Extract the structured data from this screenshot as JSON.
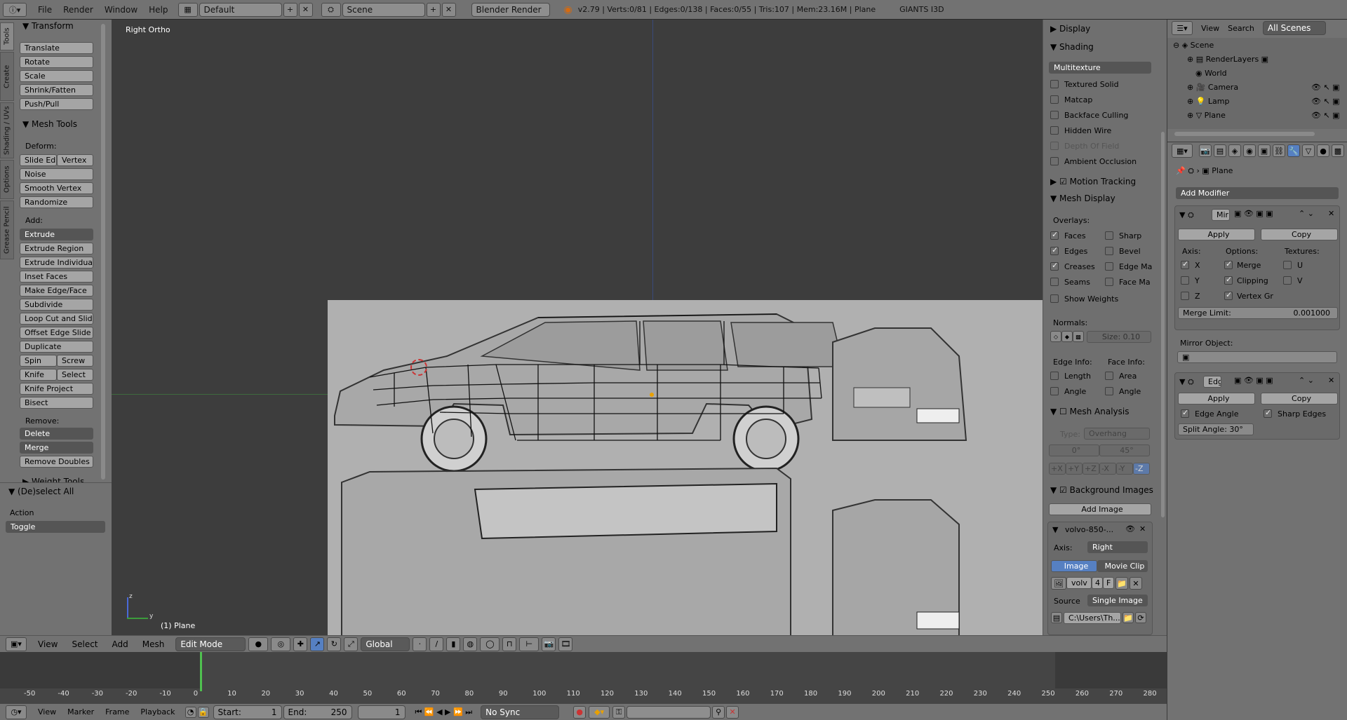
{
  "topbar": {
    "menus": [
      "File",
      "Render",
      "Window",
      "Help"
    ],
    "layout": "Default",
    "scene": "Scene",
    "engine": "Blender Render",
    "stats": "v2.79 | Verts:0/81 | Edges:0/138 | Faces:0/55 | Tris:107 | Mem:23.16M | Plane",
    "addon": "GIANTS I3D"
  },
  "tool_tabs": [
    "Tools",
    "Create",
    "Shading / UVs",
    "Options",
    "Grease Pencil"
  ],
  "tools": {
    "transform_title": "Transform",
    "transform": [
      "Translate",
      "Rotate",
      "Scale",
      "Shrink/Fatten",
      "Push/Pull"
    ],
    "mesh_tools_title": "Mesh Tools",
    "deform_label": "Deform:",
    "slide_edge": "Slide Ed",
    "vertex": "Vertex",
    "deform": [
      "Noise",
      "Smooth Vertex",
      "Randomize"
    ],
    "add_label": "Add:",
    "extrude": "Extrude",
    "add": [
      "Extrude Region",
      "Extrude Individual",
      "Inset Faces",
      "Make Edge/Face",
      "Subdivide",
      "Loop Cut and Slide",
      "Offset Edge Slide",
      "Duplicate"
    ],
    "spin": "Spin",
    "screw": "Screw",
    "knife": "Knife",
    "select": "Select",
    "knife_project": "Knife Project",
    "bisect": "Bisect",
    "remove_label": "Remove:",
    "delete": "Delete",
    "merge": "Merge",
    "remove_doubles": "Remove Doubles",
    "weight_tools": "Weight Tools"
  },
  "operator": {
    "title": "(De)select All",
    "action_label": "Action",
    "action_value": "Toggle"
  },
  "viewport": {
    "view_name": "Right Ortho",
    "object_label": "(1) Plane",
    "axis_z": "z",
    "axis_y": "y"
  },
  "viewport_header": {
    "menus": [
      "View",
      "Select",
      "Add",
      "Mesh"
    ],
    "mode": "Edit Mode",
    "orientation": "Global"
  },
  "properties_n": {
    "display": "Display",
    "shading": "Shading",
    "shading_mode": "Multitexture",
    "shading_opts": [
      {
        "label": "Textured Solid",
        "on": false
      },
      {
        "label": "Matcap",
        "on": false
      },
      {
        "label": "Backface Culling",
        "on": false
      },
      {
        "label": "Hidden Wire",
        "on": false
      },
      {
        "label": "Depth Of Field",
        "on": false
      },
      {
        "label": "Ambient Occlusion",
        "on": false
      }
    ],
    "motion_tracking": "Motion Tracking",
    "mesh_display": "Mesh Display",
    "overlays_label": "Overlays:",
    "overlays_left": [
      {
        "label": "Faces",
        "on": true
      },
      {
        "label": "Edges",
        "on": true
      },
      {
        "label": "Creases",
        "on": true
      },
      {
        "label": "Seams",
        "on": false
      }
    ],
    "overlays_right": [
      {
        "label": "Sharp",
        "on": false
      },
      {
        "label": "Bevel",
        "on": false
      },
      {
        "label": "Edge Ma",
        "on": false
      },
      {
        "label": "Face Ma",
        "on": false
      }
    ],
    "show_weights": "Show Weights",
    "normals_label": "Normals:",
    "normals_size": "Size:  0.10",
    "edge_info": "Edge Info:",
    "face_info": "Face Info:",
    "length": "Length",
    "angle": "Angle",
    "area": "Area",
    "face_angle": "Angle",
    "mesh_analysis": "Mesh Analysis",
    "type_label": "Type:",
    "type_value": "Overhang",
    "angle_min": "0°",
    "angle_max": "45°",
    "axes": [
      "+X",
      "+Y",
      "+Z",
      "-X",
      "-Y",
      "-Z"
    ],
    "bg_images": "Background Images",
    "add_image": "Add Image",
    "image_name": "volvo-850-...",
    "axis_label": "Axis:",
    "axis_value": "Right",
    "tab_image": "Image",
    "tab_movie": "Movie Clip",
    "img_field": "volv",
    "img_users": "4",
    "img_f": "F",
    "source_label": "Source",
    "source_value": "Single Image",
    "path": "C:\\Users\\Th..."
  },
  "outliner": {
    "menus": [
      "View",
      "Search"
    ],
    "filter": "All Scenes",
    "items": [
      "Scene",
      "RenderLayers",
      "World",
      "Camera",
      "Lamp",
      "Plane"
    ]
  },
  "modifiers": {
    "object_name": "Plane",
    "add_modifier": "Add Modifier",
    "mirror": {
      "name": "Mir",
      "apply": "Apply",
      "copy": "Copy",
      "axis_label": "Axis:",
      "options_label": "Options:",
      "textures_label": "Textures:",
      "axes": [
        {
          "label": "X",
          "on": true
        },
        {
          "label": "Y",
          "on": false
        },
        {
          "label": "Z",
          "on": false
        }
      ],
      "options": [
        {
          "label": "Merge",
          "on": true
        },
        {
          "label": "Clipping",
          "on": true
        },
        {
          "label": "Vertex Gr",
          "on": true
        }
      ],
      "textures": [
        {
          "label": "U",
          "on": false
        },
        {
          "label": "V",
          "on": false
        }
      ],
      "merge_limit_label": "Merge Limit:",
      "merge_limit_value": "0.001000",
      "mirror_object": "Mirror Object:"
    },
    "edgesplit": {
      "name": "Edg",
      "apply": "Apply",
      "copy": "Copy",
      "edge_angle": "Edge Angle",
      "sharp_edges": "Sharp Edges",
      "split_angle": "Split Angle: 30°"
    }
  },
  "timeline": {
    "ticks": [
      "-50",
      "-40",
      "-30",
      "-20",
      "-10",
      "0",
      "10",
      "20",
      "30",
      "40",
      "50",
      "60",
      "70",
      "80",
      "90",
      "100",
      "110",
      "120",
      "130",
      "140",
      "150",
      "160",
      "170",
      "180",
      "190",
      "200",
      "210",
      "220",
      "230",
      "240",
      "250",
      "260",
      "270",
      "280"
    ],
    "menus": [
      "View",
      "Marker",
      "Frame",
      "Playback"
    ],
    "start_label": "Start:",
    "start_value": "1",
    "end_label": "End:",
    "end_value": "250",
    "current": "1",
    "sync": "No Sync"
  }
}
